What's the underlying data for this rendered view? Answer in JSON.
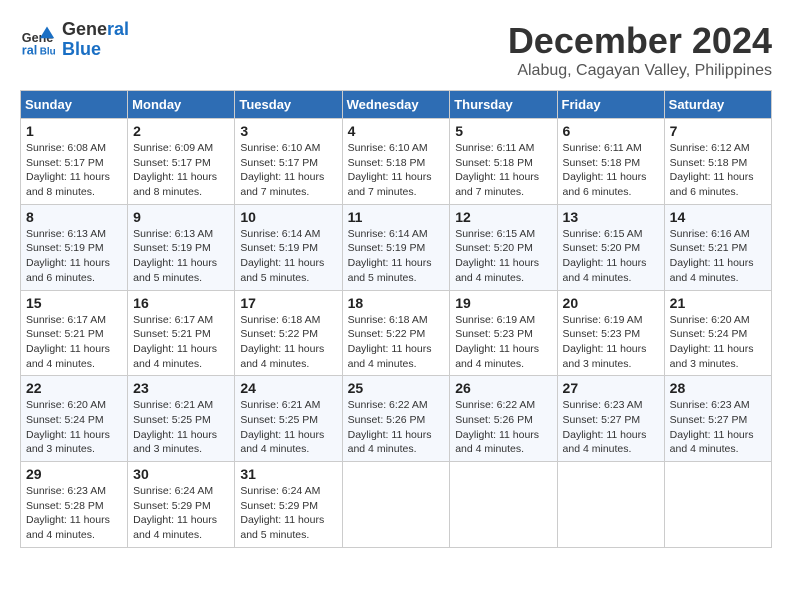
{
  "header": {
    "logo_line1": "General",
    "logo_line2": "Blue",
    "month_title": "December 2024",
    "subtitle": "Alabug, Cagayan Valley, Philippines"
  },
  "weekdays": [
    "Sunday",
    "Monday",
    "Tuesday",
    "Wednesday",
    "Thursday",
    "Friday",
    "Saturday"
  ],
  "weeks": [
    [
      {
        "day": "1",
        "info": "Sunrise: 6:08 AM\nSunset: 5:17 PM\nDaylight: 11 hours and 8 minutes."
      },
      {
        "day": "2",
        "info": "Sunrise: 6:09 AM\nSunset: 5:17 PM\nDaylight: 11 hours and 8 minutes."
      },
      {
        "day": "3",
        "info": "Sunrise: 6:10 AM\nSunset: 5:17 PM\nDaylight: 11 hours and 7 minutes."
      },
      {
        "day": "4",
        "info": "Sunrise: 6:10 AM\nSunset: 5:18 PM\nDaylight: 11 hours and 7 minutes."
      },
      {
        "day": "5",
        "info": "Sunrise: 6:11 AM\nSunset: 5:18 PM\nDaylight: 11 hours and 7 minutes."
      },
      {
        "day": "6",
        "info": "Sunrise: 6:11 AM\nSunset: 5:18 PM\nDaylight: 11 hours and 6 minutes."
      },
      {
        "day": "7",
        "info": "Sunrise: 6:12 AM\nSunset: 5:18 PM\nDaylight: 11 hours and 6 minutes."
      }
    ],
    [
      {
        "day": "8",
        "info": "Sunrise: 6:13 AM\nSunset: 5:19 PM\nDaylight: 11 hours and 6 minutes."
      },
      {
        "day": "9",
        "info": "Sunrise: 6:13 AM\nSunset: 5:19 PM\nDaylight: 11 hours and 5 minutes."
      },
      {
        "day": "10",
        "info": "Sunrise: 6:14 AM\nSunset: 5:19 PM\nDaylight: 11 hours and 5 minutes."
      },
      {
        "day": "11",
        "info": "Sunrise: 6:14 AM\nSunset: 5:19 PM\nDaylight: 11 hours and 5 minutes."
      },
      {
        "day": "12",
        "info": "Sunrise: 6:15 AM\nSunset: 5:20 PM\nDaylight: 11 hours and 4 minutes."
      },
      {
        "day": "13",
        "info": "Sunrise: 6:15 AM\nSunset: 5:20 PM\nDaylight: 11 hours and 4 minutes."
      },
      {
        "day": "14",
        "info": "Sunrise: 6:16 AM\nSunset: 5:21 PM\nDaylight: 11 hours and 4 minutes."
      }
    ],
    [
      {
        "day": "15",
        "info": "Sunrise: 6:17 AM\nSunset: 5:21 PM\nDaylight: 11 hours and 4 minutes."
      },
      {
        "day": "16",
        "info": "Sunrise: 6:17 AM\nSunset: 5:21 PM\nDaylight: 11 hours and 4 minutes."
      },
      {
        "day": "17",
        "info": "Sunrise: 6:18 AM\nSunset: 5:22 PM\nDaylight: 11 hours and 4 minutes."
      },
      {
        "day": "18",
        "info": "Sunrise: 6:18 AM\nSunset: 5:22 PM\nDaylight: 11 hours and 4 minutes."
      },
      {
        "day": "19",
        "info": "Sunrise: 6:19 AM\nSunset: 5:23 PM\nDaylight: 11 hours and 4 minutes."
      },
      {
        "day": "20",
        "info": "Sunrise: 6:19 AM\nSunset: 5:23 PM\nDaylight: 11 hours and 3 minutes."
      },
      {
        "day": "21",
        "info": "Sunrise: 6:20 AM\nSunset: 5:24 PM\nDaylight: 11 hours and 3 minutes."
      }
    ],
    [
      {
        "day": "22",
        "info": "Sunrise: 6:20 AM\nSunset: 5:24 PM\nDaylight: 11 hours and 3 minutes."
      },
      {
        "day": "23",
        "info": "Sunrise: 6:21 AM\nSunset: 5:25 PM\nDaylight: 11 hours and 3 minutes."
      },
      {
        "day": "24",
        "info": "Sunrise: 6:21 AM\nSunset: 5:25 PM\nDaylight: 11 hours and 4 minutes."
      },
      {
        "day": "25",
        "info": "Sunrise: 6:22 AM\nSunset: 5:26 PM\nDaylight: 11 hours and 4 minutes."
      },
      {
        "day": "26",
        "info": "Sunrise: 6:22 AM\nSunset: 5:26 PM\nDaylight: 11 hours and 4 minutes."
      },
      {
        "day": "27",
        "info": "Sunrise: 6:23 AM\nSunset: 5:27 PM\nDaylight: 11 hours and 4 minutes."
      },
      {
        "day": "28",
        "info": "Sunrise: 6:23 AM\nSunset: 5:27 PM\nDaylight: 11 hours and 4 minutes."
      }
    ],
    [
      {
        "day": "29",
        "info": "Sunrise: 6:23 AM\nSunset: 5:28 PM\nDaylight: 11 hours and 4 minutes."
      },
      {
        "day": "30",
        "info": "Sunrise: 6:24 AM\nSunset: 5:29 PM\nDaylight: 11 hours and 4 minutes."
      },
      {
        "day": "31",
        "info": "Sunrise: 6:24 AM\nSunset: 5:29 PM\nDaylight: 11 hours and 5 minutes."
      },
      null,
      null,
      null,
      null
    ]
  ]
}
